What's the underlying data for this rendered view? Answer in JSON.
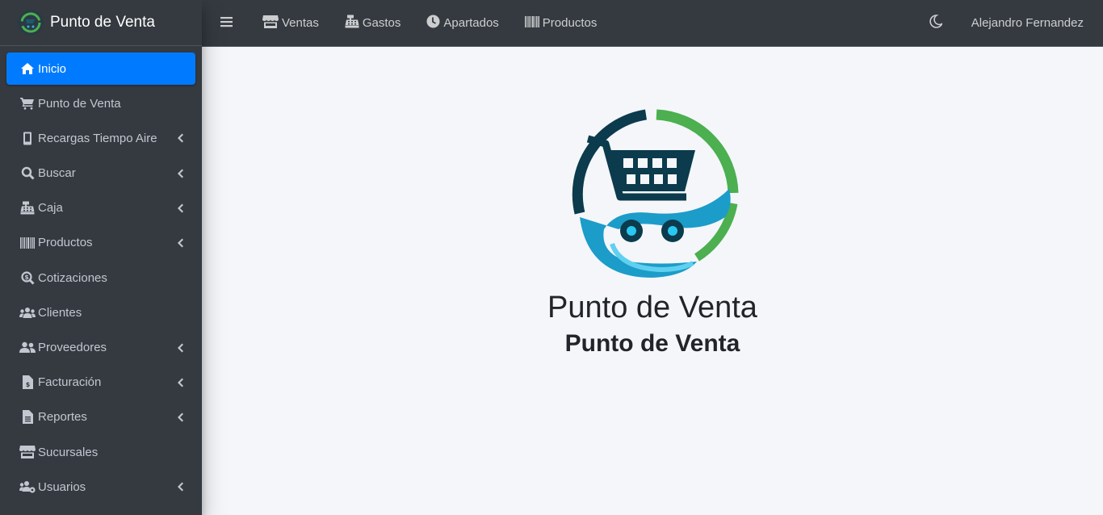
{
  "brand": {
    "name": "Punto de Venta"
  },
  "sidebar": {
    "items": [
      {
        "label": "Inicio",
        "active": true,
        "has_submenu": false
      },
      {
        "label": "Punto de Venta",
        "has_submenu": false
      },
      {
        "label": "Recargas Tiempo Aire",
        "has_submenu": true
      },
      {
        "label": "Buscar",
        "has_submenu": true
      },
      {
        "label": "Caja",
        "has_submenu": true
      },
      {
        "label": "Productos",
        "has_submenu": true
      },
      {
        "label": "Cotizaciones",
        "has_submenu": false
      },
      {
        "label": "Clientes",
        "has_submenu": false
      },
      {
        "label": "Proveedores",
        "has_submenu": true
      },
      {
        "label": "Facturación",
        "has_submenu": true
      },
      {
        "label": "Reportes",
        "has_submenu": true
      },
      {
        "label": "Sucursales",
        "has_submenu": false
      },
      {
        "label": "Usuarios",
        "has_submenu": true
      }
    ]
  },
  "topbar": {
    "links": [
      {
        "label": "Ventas",
        "icon": "store-icon"
      },
      {
        "label": "Gastos",
        "icon": "cash-register-icon"
      },
      {
        "label": "Apartados",
        "icon": "clock-icon"
      },
      {
        "label": "Productos",
        "icon": "barcode-icon"
      }
    ],
    "user_name": "Alejandro Fernandez"
  },
  "main": {
    "title": "Punto de Venta",
    "subtitle": "Punto de Venta"
  },
  "colors": {
    "sidebar_bg": "#343a40",
    "active_item": "#007bff",
    "content_bg": "#f4f6f9",
    "logo_dark": "#0b3b4c",
    "logo_green": "#4caf50",
    "logo_cyan": "#29b6e6"
  }
}
